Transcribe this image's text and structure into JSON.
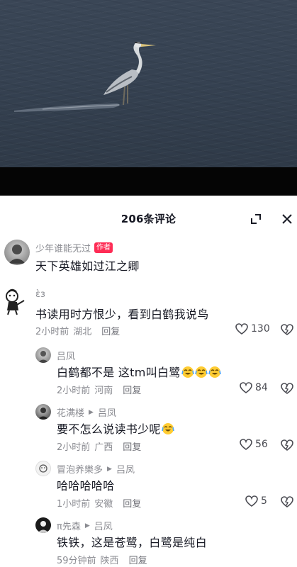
{
  "header": {
    "comment_count": "206条评论"
  },
  "comments": [
    {
      "user": "少年谁能无过",
      "tag": "作者",
      "text": "天下英雄如过江之卿"
    },
    {
      "user": "ὲɜ",
      "text": "书读用时方恨少，看到白鹤我说鸟",
      "time": "2小时前",
      "location": "湖北",
      "reply": "回复",
      "likes": "130",
      "replies": [
        {
          "user": "吕凤",
          "text": "白鹤都不是 这tm叫白鹭",
          "emoji": "laugh-cry-emoji",
          "time": "2小时前",
          "location": "河南",
          "reply": "回复",
          "likes": "84"
        },
        {
          "user": "花满楼",
          "reply_to": "吕凤",
          "text": "要不怎么说读书少呢",
          "emoji": "laugh-cry-emoji",
          "time": "2小时前",
          "location": "广西",
          "reply": "回复",
          "likes": "56"
        },
        {
          "user": "冒泡养樂多",
          "reply_to": "吕凤",
          "text": "哈哈哈哈哈",
          "time": "1小时前",
          "location": "安徽",
          "reply": "回复",
          "likes": "5"
        },
        {
          "user": "π先森",
          "reply_to": "吕凤",
          "text": "铁铁，这是苍鹭，白鹭是纯白",
          "time": "59分钟前",
          "location": "陕西",
          "reply": "回复"
        }
      ]
    }
  ],
  "colors": {
    "author_tag": "#fe2c55",
    "meta_text": "#8a8b91",
    "water": "#364252"
  }
}
